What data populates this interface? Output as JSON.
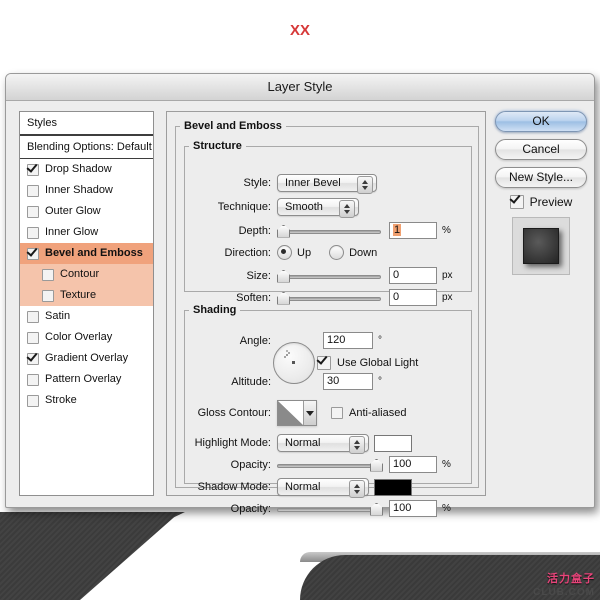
{
  "page": {
    "top_mark": "XX",
    "watermark": "活力盒子",
    "watermark_sub": "CLUB.COM"
  },
  "dialog": {
    "title": "Layer Style"
  },
  "styles_panel": {
    "header": "Styles",
    "blending_options": "Blending Options: Default",
    "effects": [
      {
        "label": "Drop Shadow",
        "checked": true,
        "sub": false,
        "selected": false
      },
      {
        "label": "Inner Shadow",
        "checked": false,
        "sub": false,
        "selected": false
      },
      {
        "label": "Outer Glow",
        "checked": false,
        "sub": false,
        "selected": false
      },
      {
        "label": "Inner Glow",
        "checked": false,
        "sub": false,
        "selected": false
      },
      {
        "label": "Bevel and Emboss",
        "checked": true,
        "sub": false,
        "selected": true
      },
      {
        "label": "Contour",
        "checked": false,
        "sub": true,
        "selected": false
      },
      {
        "label": "Texture",
        "checked": false,
        "sub": true,
        "selected": false
      },
      {
        "label": "Satin",
        "checked": false,
        "sub": false,
        "selected": false
      },
      {
        "label": "Color Overlay",
        "checked": false,
        "sub": false,
        "selected": false
      },
      {
        "label": "Gradient Overlay",
        "checked": true,
        "sub": false,
        "selected": false
      },
      {
        "label": "Pattern Overlay",
        "checked": false,
        "sub": false,
        "selected": false
      },
      {
        "label": "Stroke",
        "checked": false,
        "sub": false,
        "selected": false
      }
    ]
  },
  "main": {
    "group_title": "Bevel and Emboss",
    "structure": {
      "title": "Structure",
      "style_label": "Style:",
      "style_value": "Inner Bevel",
      "technique_label": "Technique:",
      "technique_value": "Smooth",
      "depth_label": "Depth:",
      "depth_value": "1",
      "depth_unit": "%",
      "direction_label": "Direction:",
      "direction_up": "Up",
      "direction_down": "Down",
      "direction_selected": "Up",
      "size_label": "Size:",
      "size_value": "0",
      "size_unit": "px",
      "soften_label": "Soften:",
      "soften_value": "0",
      "soften_unit": "px"
    },
    "shading": {
      "title": "Shading",
      "angle_label": "Angle:",
      "angle_value": "120",
      "angle_unit": "°",
      "use_global_light": "Use Global Light",
      "use_global_light_checked": true,
      "altitude_label": "Altitude:",
      "altitude_value": "30",
      "altitude_unit": "°",
      "gloss_contour_label": "Gloss Contour:",
      "anti_aliased": "Anti-aliased",
      "anti_aliased_checked": false,
      "highlight_mode_label": "Highlight Mode:",
      "highlight_mode_value": "Normal",
      "highlight_color": "#ffffff",
      "highlight_opacity_label": "Opacity:",
      "highlight_opacity_value": "100",
      "highlight_opacity_unit": "%",
      "shadow_mode_label": "Shadow Mode:",
      "shadow_mode_value": "Normal",
      "shadow_color": "#000000",
      "shadow_opacity_label": "Opacity:",
      "shadow_opacity_value": "100",
      "shadow_opacity_unit": "%"
    }
  },
  "buttons": {
    "ok": "OK",
    "cancel": "Cancel",
    "new_style": "New Style...",
    "preview": "Preview",
    "preview_checked": true
  },
  "colors": {
    "selected_row": "#f0a27c",
    "sub_row": "#f5c4ab",
    "dialog_bg": "#ededed",
    "accent_red": "#d63838",
    "watermark_pink": "#e8447a"
  }
}
